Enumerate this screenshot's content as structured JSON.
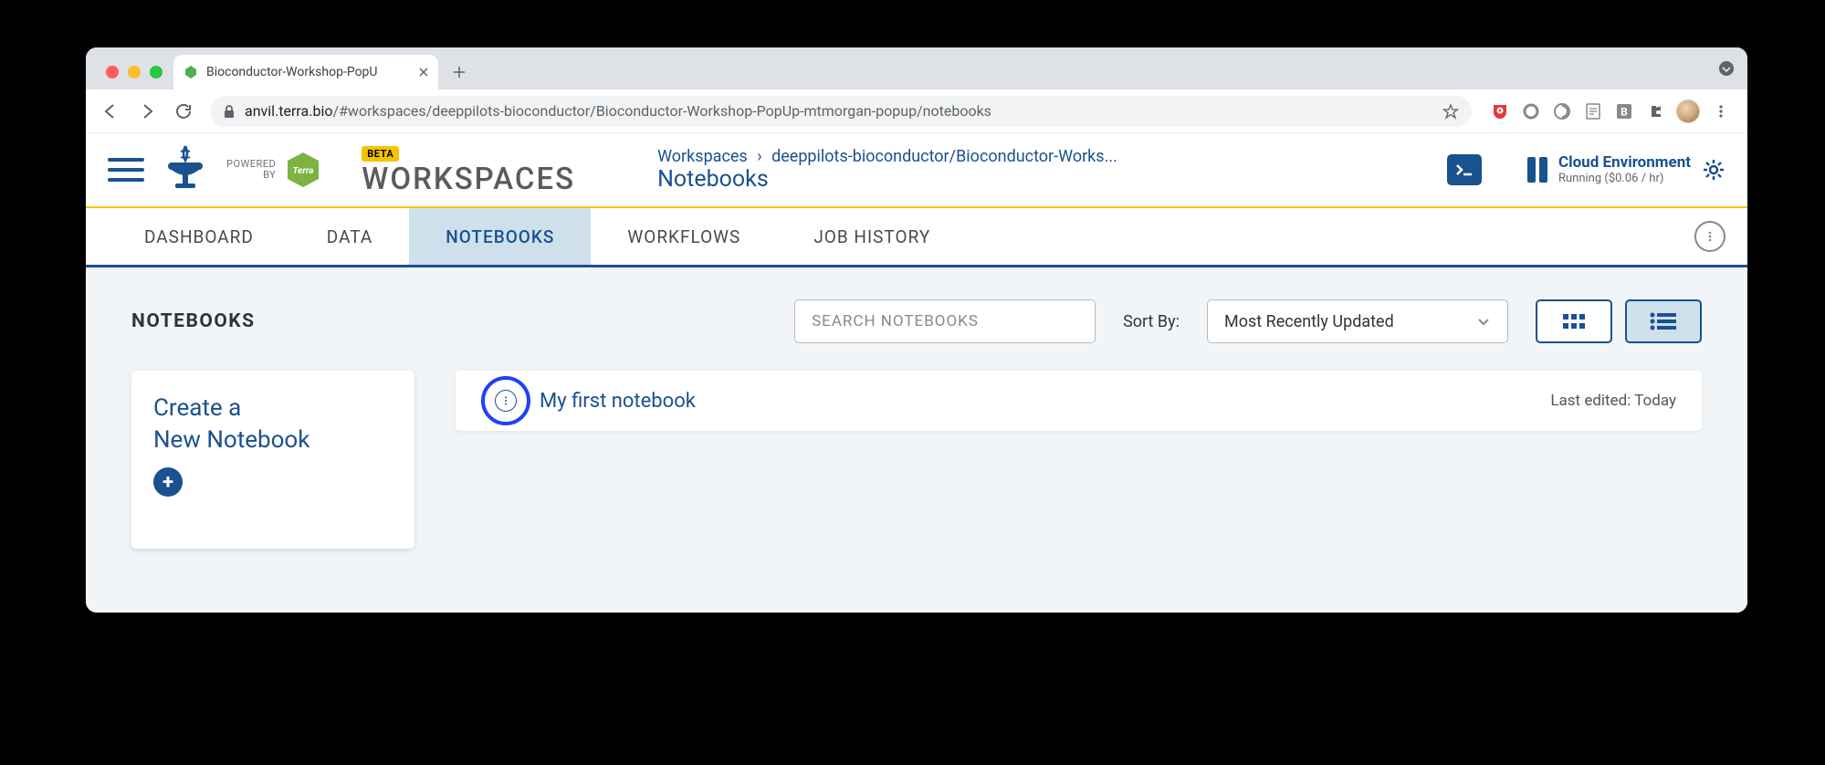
{
  "browser": {
    "tab_title": "Bioconductor-Workshop-PopU",
    "url_domain": "anvil.terra.bio",
    "url_path": "/#workspaces/deeppilots-bioconductor/Bioconductor-Workshop-PopUp-mtmorgan-popup/notebooks"
  },
  "header": {
    "powered_line1": "POWERED",
    "powered_line2": "BY",
    "terra_label": "Terra",
    "beta_label": "BETA",
    "workspaces_label": "WORKSPACES",
    "breadcrumb_root": "Workspaces",
    "breadcrumb_sep": "›",
    "breadcrumb_project": "deeppilots-bioconductor/Bioconductor-Works...",
    "breadcrumb_current": "Notebooks",
    "cloud_title": "Cloud Environment",
    "cloud_status": "Running ($0.06 / hr)"
  },
  "tabs": {
    "dashboard": "DASHBOARD",
    "data": "DATA",
    "notebooks": "NOTEBOOKS",
    "workflows": "WORKFLOWS",
    "job_history": "JOB HISTORY"
  },
  "notebooks": {
    "heading": "NOTEBOOKS",
    "search_placeholder": "SEARCH NOTEBOOKS",
    "sort_label": "Sort By:",
    "sort_value": "Most Recently Updated",
    "create_line1": "Create a",
    "create_line2": "New Notebook",
    "item_title": "My first notebook",
    "item_edited": "Last edited: Today"
  }
}
